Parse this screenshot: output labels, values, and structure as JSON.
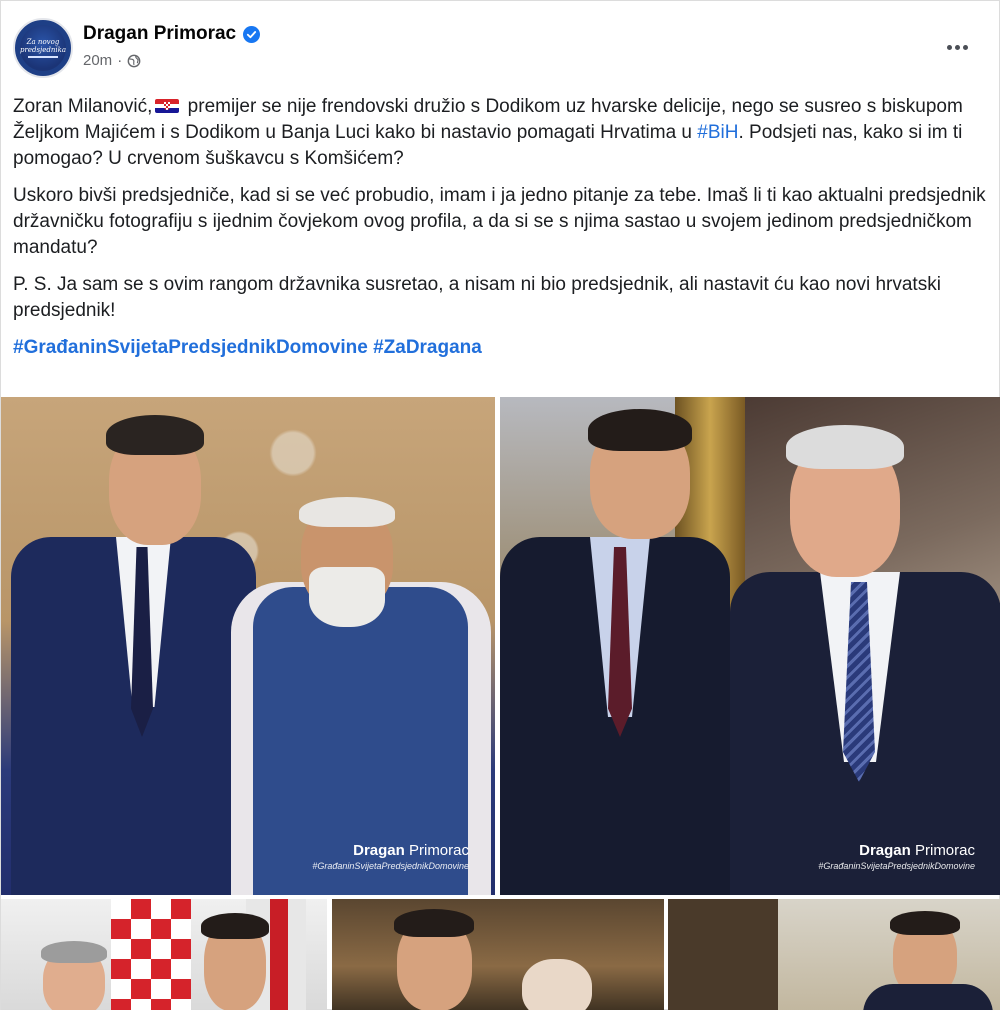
{
  "post": {
    "author": "Dragan Primorac",
    "verified": true,
    "timestamp": "20m",
    "privacy_icon": "globe-icon",
    "more_icon": "more-options-icon",
    "avatar": {
      "text": "Za novog predsjednika",
      "bg_color": "#1e3f86"
    },
    "paragraph1": {
      "before_flag": "Zoran Milanović,",
      "flag_icon": "croatia-flag-icon",
      "after_flag": " premijer se nije frendovski družio s Dodikom uz hvarske delicije, nego se susreo s biskupom Željkom Majićem i s Dodikom u Banja Luci kako bi nastavio pomagati Hrvatima u ",
      "hashtag": "#BiH",
      "after_hashtag": ". Podsjeti nas, kako si im ti pomogao? U crvenom šuškavcu s Komšićem?"
    },
    "paragraph2": "Uskoro bivši predsjedniče, kad si se već probudio, imam i ja jedno pitanje za tebe. Imaš li ti kao aktualni predsjednik državničku fotografiju s ijednim čovjekom ovog profila, a da si se s njima sastao u svojem jedinom predsjedničkom mandatu?",
    "paragraph3": "P. S. Ja sam se s ovim rangom državnika susretao, a nisam ni bio predsjednik, ali nastavit ću kao novi hrvatski predsjednik!",
    "hashtag1": "#GrađaninSvijetaPredsjednikDomovine",
    "hashtag2": "#ZaDragana",
    "photos": [
      {
        "watermark_first": "Dragan",
        "watermark_last": " Primorac",
        "watermark_tag": "#GrađaninSvijetaPredsjednikDomovine"
      },
      {
        "watermark_first": "Dragan",
        "watermark_last": " Primorac",
        "watermark_tag": "#GrađaninSvijetaPredsjednikDomovine"
      }
    ],
    "colors": {
      "link": "#216fdb",
      "verified": "#1877f2",
      "meta_text": "#65676b"
    }
  }
}
